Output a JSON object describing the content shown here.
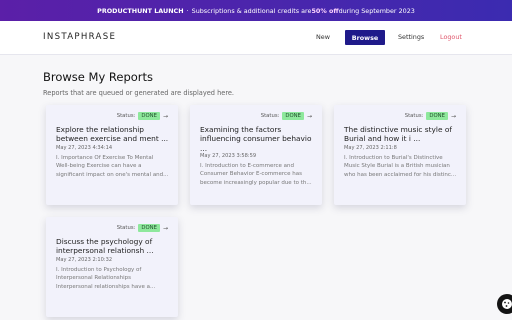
{
  "banner": {
    "launch": "PRODUCTHUNT LAUNCH",
    "separator": "·",
    "text_before": "Subscriptions & additional credits are ",
    "discount": "50% off",
    "text_after": " during September 2023"
  },
  "header": {
    "logo": "INSTAPHRASE",
    "nav": {
      "new": "New",
      "browse": "Browse",
      "settings": "Settings",
      "logout": "Logout"
    }
  },
  "page": {
    "title": "Browse My Reports",
    "subtitle": "Reports that are queued or generated are displayed here."
  },
  "reports": [
    {
      "status_label": "Status:",
      "status": "DONE",
      "arrow": "→",
      "title": "Explore the relationship\nbetween exercise and ment ...",
      "date": "May 27, 2023 4:34:14",
      "excerpt": "I. Importance Of Exercise To Mental\nWell-being Exercise can have a\nsignificant impact on one's mental and..."
    },
    {
      "status_label": "Status:",
      "status": "DONE",
      "arrow": "→",
      "title": "Examining the factors\ninfluencing consumer behavio\n...",
      "date": "May 27, 2023 3:58:59",
      "excerpt": "I. Introduction to E-commerce and\nConsumer Behavior E-commerce has\nbecome increasingly popular due to th..."
    },
    {
      "status_label": "Status:",
      "status": "DONE",
      "arrow": "→",
      "title": "The distinctive music style of\nBurial and how it i ...",
      "date": "May 27, 2023 2:11:8",
      "excerpt": "I. Introduction to Burial's Distinctive\nMusic Style Burial is a British musician\nwho has been acclaimed for his distinc..."
    },
    {
      "status_label": "Status:",
      "status": "DONE",
      "arrow": "→",
      "title": "Discuss the psychology of\ninterpersonal relationsh ...",
      "date": "May 27, 2023 2:10:32",
      "excerpt": "I. Introduction to Psychology of\nInterpersonal Relationships\nInterpersonal relationships have a..."
    }
  ],
  "fab": {
    "icon": "cookie-icon"
  }
}
